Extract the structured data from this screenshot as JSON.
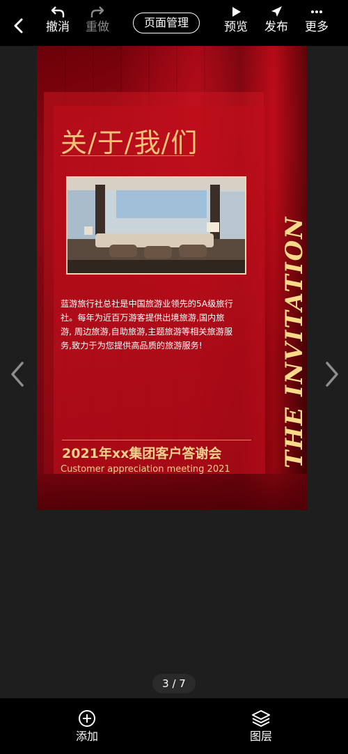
{
  "toolbar": {
    "undo": "撤消",
    "redo": "重做",
    "page_manage": "页面管理",
    "preview": "预览",
    "publish": "发布",
    "more": "更多"
  },
  "slide": {
    "title": "关/于/我/们",
    "description": "蓝游旅行社总社是中国旅游业领先的5A级旅行社。每年为近百万游客提供出境旅游,国内旅游, 周边旅游,自助旅游,主题旅游等相关旅游服务,致力于为您提供高品质的旅游服务!",
    "event_title": "2021年xx集团客户答谢会",
    "event_subtitle": "Customer appreciation meeting 2021",
    "vertical_text": "THE INVITATION"
  },
  "pager": {
    "current": "3 / 7"
  },
  "bottom": {
    "add": "添加",
    "layers": "图层"
  },
  "colors": {
    "accent_gold": "#f1c27a",
    "slide_red": "#a00a18",
    "bar_bg": "#000000"
  }
}
